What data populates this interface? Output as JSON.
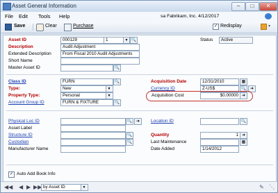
{
  "window": {
    "title": "Asset General Information",
    "company_date": "sa  Fabrikam, Inc. 4/12/2017"
  },
  "menu": [
    "File",
    "Edit",
    "Tools",
    "Help"
  ],
  "toolbar": {
    "save": "Save",
    "clear": "Clear",
    "purchase": "Purchase",
    "redisplay": "Redisplay"
  },
  "header": {
    "asset_id_label": "Asset ID",
    "asset_id": "000129",
    "asset_suffix": "1",
    "status_label": "Status",
    "status": "Active",
    "description_label": "Description",
    "description": "Audit Adjustment",
    "ext_desc_label": "Extended Description",
    "ext_desc": "From Fiscal 2010 Audit Adjustments",
    "short_name_label": "Short Name",
    "short_name": "",
    "master_asset_label": "Master Asset ID",
    "master_asset": ""
  },
  "section2": {
    "class_id_label": "Class ID",
    "class_id": "FURN",
    "type_label": "Type:",
    "type": "New",
    "property_type_label": "Property Type:",
    "property_type": "Personal",
    "account_group_label": "Account Group ID",
    "account_group": "FURN & FIXTURE",
    "acq_date_label": "Acquisition Date",
    "acq_date": "12/31/2010",
    "currency_label": "Currency ID",
    "currency": "Z-US$",
    "acq_cost_label": "Acquisition Cost",
    "acq_cost": "$0.00000"
  },
  "section3": {
    "physical_loc_label": "Physical Loc ID",
    "physical_loc": "",
    "asset_label_label": "Asset Label",
    "asset_label": "",
    "structure_label": "Structure ID",
    "structure": "",
    "custodian_label": "Custodian",
    "custodian": "",
    "manufacturer_label": "Manufacturer Name",
    "manufacturer": "",
    "location_label": "Location ID",
    "location": "",
    "quantity_label": "Quantity",
    "quantity": "1",
    "last_maint_label": "Last Maintenance",
    "last_maint": "",
    "date_added_label": "Date Added",
    "date_added": "1/14/2012"
  },
  "footer": {
    "auto_add": "Auto Add Book Info"
  },
  "statusbar": {
    "sort": "by Asset ID"
  },
  "colors": {
    "accent_red": "#b40000",
    "link_blue": "#1a3fb0",
    "highlight": "#c0302e"
  }
}
